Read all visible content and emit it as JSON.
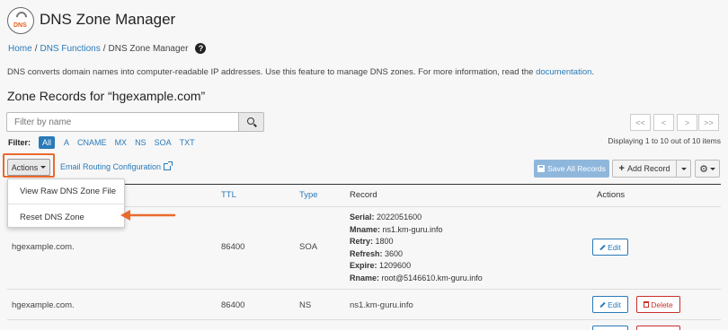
{
  "app": {
    "title": "DNS Zone Manager",
    "logo_text": "DNS"
  },
  "breadcrumb": {
    "home": "Home",
    "sep1": "/",
    "functions": "DNS Functions",
    "sep2": "/",
    "current": "DNS Zone Manager"
  },
  "description": {
    "text": "DNS converts domain names into computer-readable IP addresses. Use this feature to manage DNS zones. For more information, read the ",
    "link": "documentation",
    "end": "."
  },
  "section_title": "Zone Records for “hgexample.com”",
  "search": {
    "placeholder": "Filter by name"
  },
  "pagination": {
    "first": "<<",
    "prev": "<",
    "next": ">",
    "last": ">>",
    "info": "Displaying 1 to 10 out of 10 items"
  },
  "filter": {
    "label": "Filter:",
    "items": [
      "All",
      "A",
      "CNAME",
      "MX",
      "NS",
      "SOA",
      "TXT"
    ],
    "active": "All"
  },
  "toolbar": {
    "actions_label": "Actions",
    "email_routing": "Email Routing Configuration",
    "save_all": "Save All Records",
    "add_record": "Add Record"
  },
  "dropdown": {
    "items": [
      "View Raw DNS Zone File",
      "Reset DNS Zone"
    ]
  },
  "table": {
    "columns": [
      "TTL",
      "Type",
      "Record",
      "Actions"
    ],
    "rows": [
      {
        "name": "hgexample.com.",
        "ttl": "86400",
        "type": "SOA",
        "record": [
          {
            "key": "Serial:",
            "value": "2022051600"
          },
          {
            "key": "Mname:",
            "value": "ns1.km-guru.info"
          },
          {
            "key": "Retry:",
            "value": "1800"
          },
          {
            "key": "Refresh:",
            "value": "3600"
          },
          {
            "key": "Expire:",
            "value": "1209600"
          },
          {
            "key": "Rname:",
            "value": "root@5146610.km-guru.info"
          }
        ],
        "edit": "Edit"
      },
      {
        "name": "hgexample.com.",
        "ttl": "86400",
        "type": "NS",
        "record_text": "ns1.km-guru.info",
        "edit": "Edit",
        "delete": "Delete"
      }
    ]
  },
  "colors": {
    "accent": "#2a7ab8",
    "highlight": "#ea6a2c",
    "danger": "#c9302c"
  },
  "icons": [
    "dns-logo-icon",
    "help-icon",
    "search-icon",
    "external-link-icon",
    "save-icon",
    "plus-icon",
    "gear-icon",
    "pencil-icon",
    "trash-icon",
    "arrow-icon"
  ]
}
